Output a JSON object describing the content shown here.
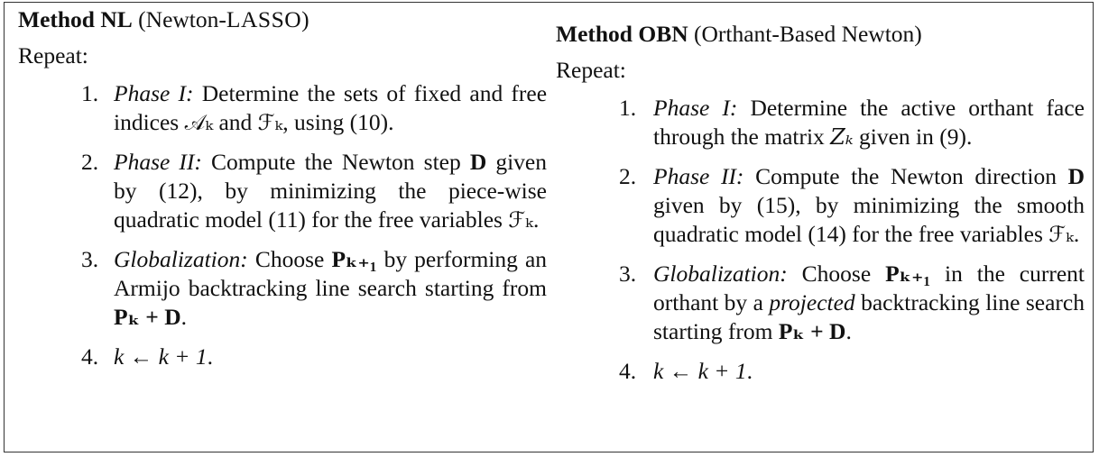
{
  "left": {
    "title": "Method NL",
    "subtitle_open": "(Newton-",
    "subtitle_sc": "LASSO",
    "subtitle_close": ")",
    "repeat": "Repeat:",
    "items": [
      {
        "num": "1.",
        "label": "Phase I:",
        "text_a": "Determine the sets of fixed and free indices",
        "sym1": "𝒜ₖ",
        "and": "and",
        "sym2": "ℱₖ",
        "text_b": ", using",
        "ref": "(10)",
        "end": "."
      },
      {
        "num": "2.",
        "label": "Phase II:",
        "text_a": "Compute the Newton step",
        "sym": "D",
        "text_b": "given by",
        "ref1": "(12)",
        "text_c": ", by minimizing the piece-wise quadratic model (11) for the free variables",
        "sym2": "ℱₖ",
        "end": "."
      },
      {
        "num": "3.",
        "label": "Globalization:",
        "text_a": "Choose",
        "sym": "Pₖ₊₁",
        "text_b": "by performing an Armijo backtracking line search starting from",
        "sym2": "Pₖ + D",
        "end": "."
      },
      {
        "num": "4.",
        "sym": "k ← k + 1",
        "end": "."
      }
    ]
  },
  "right": {
    "title": "Method OBN",
    "subtitle": "(Orthant-Based Newton)",
    "repeat": "Repeat:",
    "items": [
      {
        "num": "1.",
        "label": "Phase I:",
        "text_a": "Determine the active orthant face through the matrix",
        "sym": "Zₖ",
        "text_b": "given in",
        "ref": "(9)",
        "end": "."
      },
      {
        "num": "2.",
        "label": "Phase II:",
        "text_a": "Compute the Newton direction",
        "sym": "D",
        "text_b": "given by",
        "ref1": "(15)",
        "text_c": ", by minimizing the smooth quadratic model (14) for the free variables",
        "sym2": "ℱₖ",
        "end": "."
      },
      {
        "num": "3.",
        "label": "Globalization:",
        "text_a": "Choose",
        "sym": "Pₖ₊₁",
        "text_b": "in the current orthant by a",
        "emph": "projected",
        "text_c": "backtracking line search starting from",
        "sym2": "Pₖ + D",
        "end": "."
      },
      {
        "num": "4.",
        "sym": "k ← k + 1",
        "end": "."
      }
    ]
  }
}
